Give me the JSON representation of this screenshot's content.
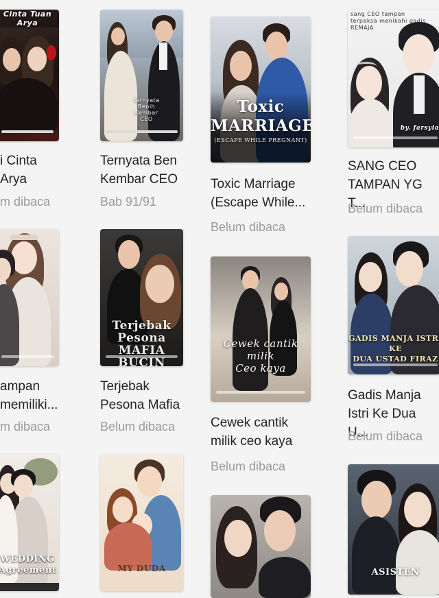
{
  "books": [
    {
      "title": "i Cinta\nArya",
      "status": "m dibaca",
      "cover_text": "Cinta Tuan Arya",
      "progress": 1.0
    },
    {
      "title": "Ternyata Ben\nKembar CEO",
      "status": "Bab 91/91",
      "cover_text": "Ternyata Benih Kembar CEO",
      "progress": 1.0
    },
    {
      "title": "Toxic Marriage\n(Escape While...",
      "status": "Belum dibaca",
      "cover_text": "Toxic\nMARRIAGE",
      "cover_subtext": "(ESCAPE WHILE PREGNANT)",
      "progress": 0
    },
    {
      "title": "SANG CEO\nTAMPAN YG T...",
      "status": "Belum dibaca",
      "cover_text": "sang CEO tampan\nterpaksa menikahi gadis REMAJA",
      "cover_subtext": "by. farsyia",
      "progress": 0
    },
    {
      "title": "ampan\nmemiliki...",
      "status": "m dibaca",
      "cover_text": "",
      "progress": 0
    },
    {
      "title": "Terjebak\nPesona Mafia",
      "status": "Belum dibaca",
      "cover_text": "Terjebak\nPesona\nMAFIA BUCIN",
      "progress": 0
    },
    {
      "title": "Cewek cantik\nmilik ceo kaya",
      "status": "Belum dibaca",
      "cover_text": "Cewek cantik\nmilik\nCeo kaya",
      "progress": 0
    },
    {
      "title": "Gadis Manja\nIstri Ke Dua U...",
      "status": "Belum dibaca",
      "cover_text": "GADIS MANJA ISTRI KE\nDUA USTAD FIRAZ",
      "progress": 0
    },
    {
      "title": "",
      "status": "",
      "cover_text": "WEDDING\nAgreement",
      "progress": 0
    },
    {
      "title": "",
      "status": "",
      "cover_text": "MY DUDA",
      "progress": 0
    },
    {
      "title": "",
      "status": "",
      "cover_text": "",
      "progress": 0
    },
    {
      "title": "",
      "status": "",
      "cover_text": "ASISTEN",
      "progress": 0
    }
  ]
}
